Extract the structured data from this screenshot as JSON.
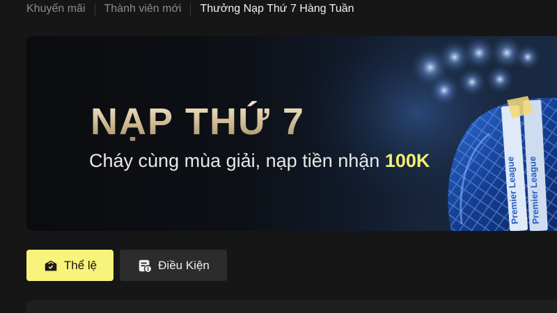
{
  "breadcrumb": {
    "items": [
      {
        "label": "Khuyến mãi"
      },
      {
        "label": "Thành viên mới"
      },
      {
        "label": "Thưởng Nạp Thứ 7 Hàng Tuần"
      }
    ]
  },
  "banner": {
    "title": "NẠP THỨ 7",
    "subtitle_prefix": "Cháy cùng mùa giải, nạp tiền nhận",
    "subtitle_highlight": "100K",
    "art_text": "Premier League",
    "highlight_color": "#f3ef6d"
  },
  "actions": {
    "rules_label": "Thể lệ",
    "rules_icon": "gift-icon",
    "conditions_label": "Điều Kiện",
    "conditions_icon": "info-card-icon",
    "rules_bg": "#f8f37a",
    "conditions_bg": "#2c2c2c"
  }
}
